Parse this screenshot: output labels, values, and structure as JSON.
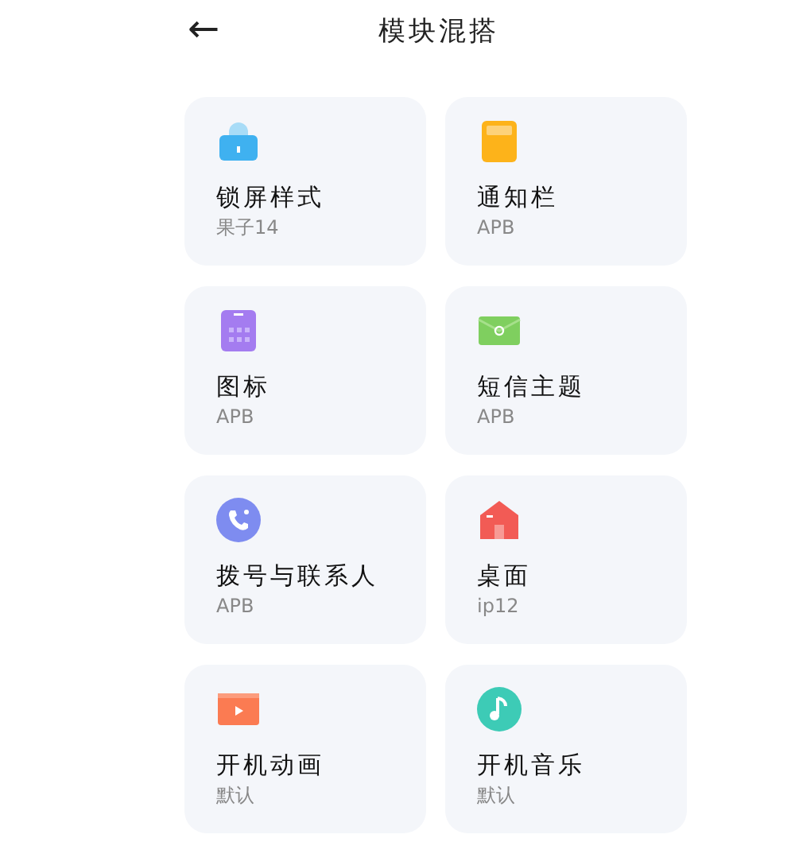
{
  "header": {
    "back": "←",
    "title": "模块混搭"
  },
  "tiles": [
    {
      "kind": "lock",
      "title": "锁屏样式",
      "subtitle": "果子14"
    },
    {
      "kind": "notification",
      "title": "通知栏",
      "subtitle": "APB"
    },
    {
      "kind": "grid",
      "title": "图标",
      "subtitle": "APB"
    },
    {
      "kind": "message",
      "title": "短信主题",
      "subtitle": "APB"
    },
    {
      "kind": "phone",
      "title": "拨号与联系人",
      "subtitle": "APB"
    },
    {
      "kind": "home",
      "title": "桌面",
      "subtitle": "ip12"
    },
    {
      "kind": "video",
      "title": "开机动画",
      "subtitle": "默认"
    },
    {
      "kind": "music",
      "title": "开机音乐",
      "subtitle": "默认"
    }
  ]
}
